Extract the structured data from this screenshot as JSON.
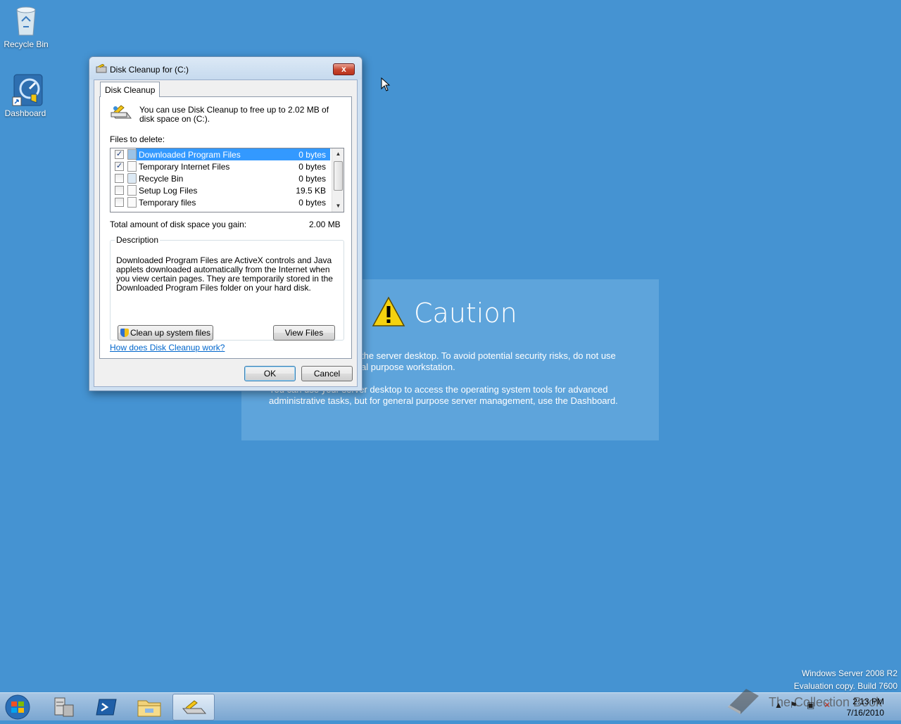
{
  "desktop": {
    "icons": [
      {
        "label": "Recycle Bin",
        "icon": "recycle-bin-icon"
      },
      {
        "label": "Dashboard",
        "icon": "dashboard-icon"
      }
    ],
    "watermark_line1": "Windows Server 2008 R2",
    "watermark_line2": "Evaluation copy. Build 7600",
    "overlay_text": "The Collection Book"
  },
  "caution": {
    "title": "Caution",
    "line1": "the server desktop. To avoid potential security risks, do not use",
    "line2": "al purpose workstation.",
    "line3": "You can use your server desktop to access the operating system tools for advanced",
    "line4": "administrative tasks, but for general purpose server management, use the Dashboard."
  },
  "dialog": {
    "title": "Disk Cleanup for  (C:)",
    "close_label": "x",
    "tab": "Disk Cleanup",
    "intro": "You can use Disk Cleanup to free up to 2.02 MB of disk space on  (C:).",
    "files_to_delete_label": "Files to delete:",
    "files": [
      {
        "name": "Downloaded Program Files",
        "size": "0 bytes",
        "checked": true,
        "selected": true
      },
      {
        "name": "Temporary Internet Files",
        "size": "0 bytes",
        "checked": true,
        "selected": false
      },
      {
        "name": "Recycle Bin",
        "size": "0 bytes",
        "checked": false,
        "selected": false
      },
      {
        "name": "Setup Log Files",
        "size": "19.5 KB",
        "checked": false,
        "selected": false
      },
      {
        "name": "Temporary files",
        "size": "0 bytes",
        "checked": false,
        "selected": false
      }
    ],
    "total_label": "Total amount of disk space you gain:",
    "total_value": "2.00 MB",
    "description_legend": "Description",
    "description": "Downloaded Program Files are ActiveX controls and Java applets downloaded automatically from the Internet when you view certain pages. They are temporarily stored in the Downloaded Program Files folder on your hard disk.",
    "cleanup_system_label": "Clean up system files",
    "view_files_label": "View Files",
    "help_link": "How does Disk Cleanup work?",
    "ok_label": "OK",
    "cancel_label": "Cancel"
  },
  "taskbar": {
    "time": "2:13 PM",
    "date": "7/16/2010",
    "buttons": [
      "server-manager-icon",
      "powershell-icon",
      "explorer-icon",
      "disk-cleanup-icon"
    ]
  }
}
